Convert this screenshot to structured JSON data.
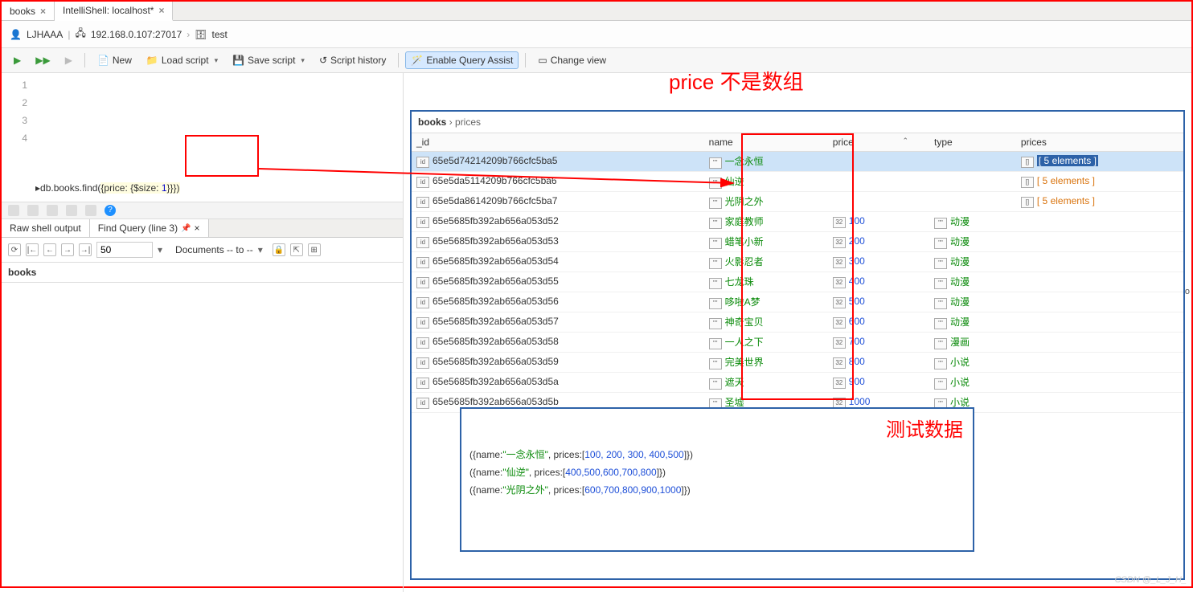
{
  "tabs": [
    {
      "label": "books"
    },
    {
      "label": "IntelliShell: localhost*"
    }
  ],
  "conn": {
    "user": "LJHAAA",
    "host": "192.168.0.107:27017",
    "db": "test"
  },
  "toolbar": {
    "new": "New",
    "load": "Load script",
    "save": "Save script",
    "history": "Script history",
    "assist": "Enable Query Assist",
    "view": "Change view"
  },
  "editor": {
    "lines": [
      "1",
      "2",
      "3",
      "4"
    ],
    "code_prefix": "db.books.find(",
    "code_obj1": "{price: ",
    "code_obj2": "{$size: ",
    "code_num": "1",
    "code_suffix": "}})"
  },
  "annot": {
    "title": "price 不是数组",
    "test_title": "测试数据"
  },
  "subtabs": [
    {
      "label": "Raw shell output"
    },
    {
      "label": "Find Query (line 3)"
    }
  ],
  "nav": {
    "page": "50",
    "docs": "Documents -- to --"
  },
  "result_header": "books",
  "crumb": {
    "a": "books",
    "b": "prices"
  },
  "columns": [
    "_id",
    "name",
    "price",
    "type",
    "prices"
  ],
  "rows": [
    {
      "id": "65e5d74214209b766cfc5ba5",
      "name": "一念永恒",
      "price": "",
      "type": "",
      "prices": "[ 5 elements ]",
      "sel": true
    },
    {
      "id": "65e5da5114209b766cfc5ba6",
      "name": "仙逆",
      "price": "",
      "type": "",
      "prices": "[ 5 elements ]"
    },
    {
      "id": "65e5da8614209b766cfc5ba7",
      "name": "光阴之外",
      "price": "",
      "type": "",
      "prices": "[ 5 elements ]"
    },
    {
      "id": "65e5685fb392ab656a053d52",
      "name": "家庭教师",
      "price": "100",
      "type": "动漫"
    },
    {
      "id": "65e5685fb392ab656a053d53",
      "name": "蜡笔小新",
      "price": "200",
      "type": "动漫"
    },
    {
      "id": "65e5685fb392ab656a053d54",
      "name": "火影忍者",
      "price": "300",
      "type": "动漫"
    },
    {
      "id": "65e5685fb392ab656a053d55",
      "name": "七龙珠",
      "price": "400",
      "type": "动漫"
    },
    {
      "id": "65e5685fb392ab656a053d56",
      "name": "哆啦A梦",
      "price": "500",
      "type": "动漫"
    },
    {
      "id": "65e5685fb392ab656a053d57",
      "name": "神奇宝贝",
      "price": "600",
      "type": "动漫"
    },
    {
      "id": "65e5685fb392ab656a053d58",
      "name": "一人之下",
      "price": "700",
      "type": "漫画"
    },
    {
      "id": "65e5685fb392ab656a053d59",
      "name": "完美世界",
      "price": "800",
      "type": "小说"
    },
    {
      "id": "65e5685fb392ab656a053d5a",
      "name": "遮天",
      "price": "900",
      "type": "小说"
    },
    {
      "id": "65e5685fb392ab656a053d5b",
      "name": "圣墟",
      "price": "1000",
      "type": "小说"
    }
  ],
  "test_lines": [
    {
      "pre": "({name:",
      "str": "\"一念永恒\"",
      "mid": ", prices:[",
      "nums": "100, 200, 300, 400,500",
      "post": "]})"
    },
    {
      "pre": "({name:",
      "str": "\"仙逆\"",
      "mid": ", prices:[",
      "nums": "400,500,600,700,800",
      "post": "]})"
    },
    {
      "pre": "({name:",
      "str": "\"光阴之外\"",
      "mid": ", prices:[",
      "nums": "600,700,800,900,1000",
      "post": "]})"
    }
  ],
  "watermark": "CSDN @_L_J_H_",
  "code_label": "Co"
}
